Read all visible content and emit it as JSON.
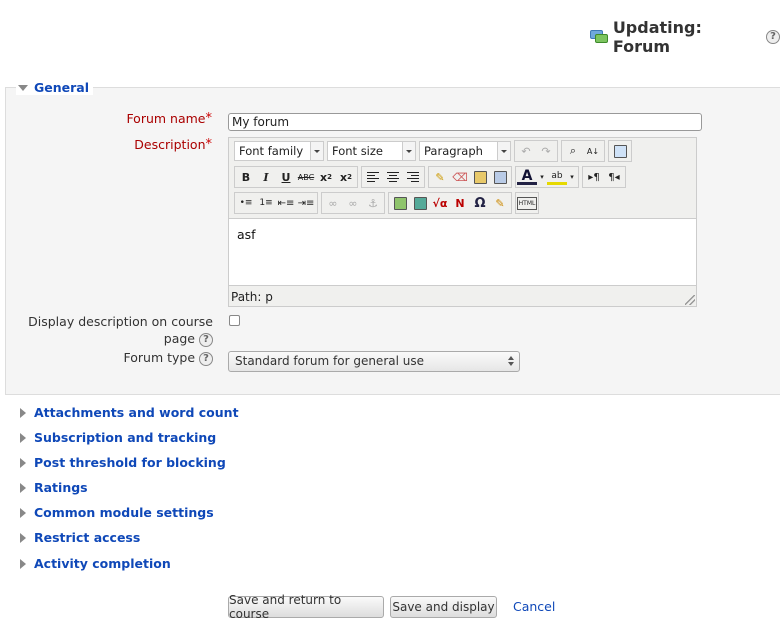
{
  "header": {
    "title": "Updating: Forum"
  },
  "general": {
    "legend": "General",
    "forum_name": {
      "label": "Forum name",
      "value": "My forum"
    },
    "description": {
      "label": "Description",
      "toolbar": {
        "font_family": "Font family",
        "font_size": "Font size",
        "format": "Paragraph"
      },
      "content": "asf",
      "path": "Path: p"
    },
    "display_description": {
      "label_line1": "Display description on course",
      "label_line2": "page",
      "checked": false
    },
    "forum_type": {
      "label": "Forum type",
      "value": "Standard forum for general use"
    }
  },
  "sections": [
    "Attachments and word count",
    "Subscription and tracking",
    "Post threshold for blocking",
    "Ratings",
    "Common module settings",
    "Restrict access",
    "Activity completion"
  ],
  "buttons": {
    "save_return": "Save and return to course",
    "save_display": "Save and display",
    "cancel": "Cancel"
  }
}
